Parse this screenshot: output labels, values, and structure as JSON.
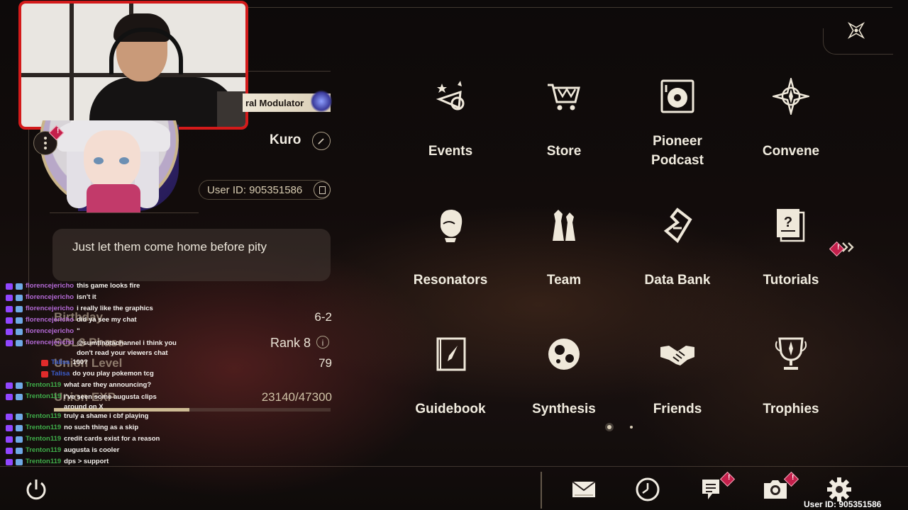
{
  "profile": {
    "modulator_label": "ral Modulator",
    "username": "Kuro",
    "user_id": "User ID: 905351586",
    "signature": "Just let them come home before pity"
  },
  "stats": {
    "birthday_label": "Birthday",
    "birthday_value": "6-2",
    "sol_phase_label": "SOL3 Phase",
    "sol_phase_value": "Rank 8",
    "union_level_label": "Union Level",
    "union_level_value": "79",
    "union_exp_label": "Union EXP",
    "union_exp_value": "23140/47300",
    "union_exp_progress": 0.489
  },
  "menu": [
    {
      "label": "Events",
      "icon": "events-icon"
    },
    {
      "label": "Store",
      "icon": "store-cart-icon"
    },
    {
      "label": "Pioneer Podcast",
      "icon": "podcast-turntable-icon"
    },
    {
      "label": "Convene",
      "icon": "convene-star-icon"
    },
    {
      "label": "Resonators",
      "icon": "resonator-character-icon"
    },
    {
      "label": "Team",
      "icon": "team-figures-icon"
    },
    {
      "label": "Data Bank",
      "icon": "data-bank-icon"
    },
    {
      "label": "Tutorials",
      "icon": "tutorials-question-icon"
    },
    {
      "label": "Guidebook",
      "icon": "guidebook-compass-icon"
    },
    {
      "label": "Synthesis",
      "icon": "synthesis-icon"
    },
    {
      "label": "Friends",
      "icon": "handshake-icon"
    },
    {
      "label": "Trophies",
      "icon": "trophy-icon"
    }
  ],
  "pagination": {
    "current_page": 1,
    "total_pages": 2
  },
  "bottom_bar": {
    "icons": [
      "power-icon",
      "mail-icon",
      "clock-icon",
      "notice-icon",
      "camera-icon",
      "settings-gear-icon"
    ],
    "user_id": "User ID: 905351586"
  },
  "chat": [
    {
      "platform": "twitch",
      "user": "florencejericho",
      "message": "this game looks fire",
      "user_color": "#b46ad6"
    },
    {
      "platform": "twitch",
      "user": "florencejericho",
      "message": "isn't it",
      "user_color": "#b46ad6"
    },
    {
      "platform": "twitch",
      "user": "florencejericho",
      "message": "i really like the graphics",
      "user_color": "#b46ad6"
    },
    {
      "platform": "twitch",
      "user": "florencejericho",
      "message": "did ya see my chat",
      "user_color": "#b46ad6"
    },
    {
      "platform": "twitch",
      "user": "florencejericho",
      "message": "\"",
      "user_color": "#b46ad6"
    },
    {
      "platform": "twitch",
      "user": "florencejericho",
      "message": "@sumtinotachannel i think you don't read your viewers chat",
      "user_color": "#b46ad6"
    },
    {
      "platform": "youtube",
      "user": "Talisa",
      "message": "100?",
      "user_color": "#3b5cc9"
    },
    {
      "platform": "youtube",
      "user": "Talisa",
      "message": "do you play pokemon tcg",
      "user_color": "#3b5cc9"
    },
    {
      "platform": "twitch",
      "user": "Trenton119",
      "message": "what are they announcing?",
      "user_color": "#3fae4a"
    },
    {
      "platform": "twitch",
      "user": "Trenton119",
      "message": "i've seen some augusta clips around on X",
      "user_color": "#3fae4a"
    },
    {
      "platform": "twitch",
      "user": "Trenton119",
      "message": "truly a shame i cbf playing",
      "user_color": "#3fae4a"
    },
    {
      "platform": "twitch",
      "user": "Trenton119",
      "message": "no such thing as a skip",
      "user_color": "#3fae4a"
    },
    {
      "platform": "twitch",
      "user": "Trenton119",
      "message": "credit cards exist for a reason",
      "user_color": "#3fae4a"
    },
    {
      "platform": "twitch",
      "user": "Trenton119",
      "message": "augusta is cooler",
      "user_color": "#3fae4a"
    },
    {
      "platform": "twitch",
      "user": "Trenton119",
      "message": "dps > support",
      "user_color": "#3fae4a"
    }
  ],
  "colors": {
    "alert": "#c41f4b",
    "webcam_border": "#d31a1a",
    "accent_gold": "#cdbb94"
  }
}
